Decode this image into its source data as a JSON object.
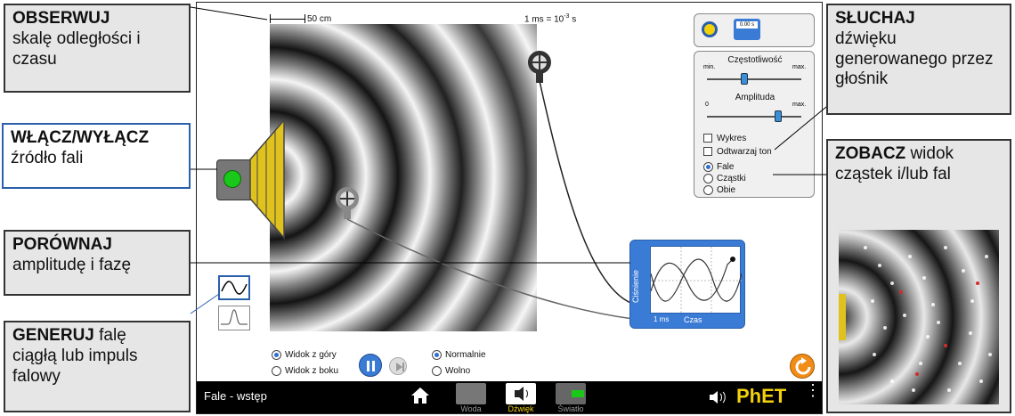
{
  "callouts": {
    "observe": {
      "bold": "OBSERWUJ",
      "rest": "skalę odległości i czasu"
    },
    "power": {
      "bold": "WŁĄCZ/WYŁĄCZ",
      "rest": "źródło fali"
    },
    "compare": {
      "bold": "PORÓWNAJ",
      "rest": "amplitudę i fazę"
    },
    "generate": {
      "bold": "GENERUJ",
      "rest_inline": "falę",
      "rest": "ciągłą lub impuls falowy"
    },
    "listen": {
      "bold": "SŁUCHAJ",
      "rest": "dźwięku generowanego przez głośnik"
    },
    "see": {
      "bold": "ZOBACZ",
      "rest_inline": "widok",
      "rest": "cząstek i/lub fal"
    }
  },
  "sim": {
    "scale_label": "50 cm",
    "time_label_prefix": "1 ms = 10",
    "time_label_exp": "-3",
    "time_label_unit": " s",
    "frequency": {
      "title": "Częstotliwość",
      "min": "min.",
      "max": "max.",
      "level": 0.4
    },
    "amplitude": {
      "title": "Amplituda",
      "min": "0",
      "max": "max.",
      "level": 0.75
    },
    "checkboxes": [
      {
        "label": "Wykres",
        "checked": false
      },
      {
        "label": "Odtwarzaj ton",
        "checked": false
      }
    ],
    "views": [
      {
        "label": "Fale",
        "selected": true
      },
      {
        "label": "Cząstki",
        "selected": false
      },
      {
        "label": "Obie",
        "selected": false
      }
    ],
    "perspective": [
      {
        "label": "Widok z góry",
        "selected": true
      },
      {
        "label": "Widok z boku",
        "selected": false
      }
    ],
    "speed": [
      {
        "label": "Normalnie",
        "selected": true
      },
      {
        "label": "Wolno",
        "selected": false
      }
    ],
    "chart": {
      "ylabel": "Ciśnienie",
      "xlabel": "Czas",
      "scale": "1 ms"
    },
    "stopwatch_display": "0.00 s"
  },
  "navbar": {
    "title": "Fale - wstęp",
    "tabs": [
      {
        "label": "Woda",
        "active": false
      },
      {
        "label": "Dźwięk",
        "active": true
      },
      {
        "label": "Światło",
        "active": false
      }
    ],
    "brand": "PhET"
  },
  "colors": {
    "accent_blue": "#3a7bd5",
    "speaker_yellow": "#e0c21e",
    "power_green": "#19c819",
    "reset_orange": "#f08c17",
    "navbar": "#000000"
  }
}
